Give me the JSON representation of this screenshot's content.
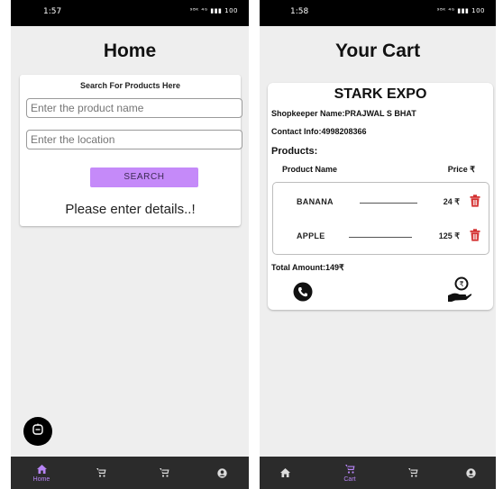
{
  "left": {
    "status": {
      "time": "1:57",
      "icons": "⁹⁸ᴷ ⁴ᴳ ▮▮▮ 100"
    },
    "title": "Home",
    "search": {
      "heading": "Search For Products Here",
      "product_placeholder": "Enter the product name",
      "location_placeholder": "Enter the location",
      "button_label": "SEARCH"
    },
    "message": "Please enter details..!",
    "nav": {
      "home_label": "Home"
    }
  },
  "right": {
    "status": {
      "time": "1:58",
      "icons": "⁹⁸ᴷ ⁴ᴳ ▮▮▮ 100"
    },
    "title": "Your Cart",
    "cart": {
      "shop_name": "STARK EXPO",
      "shopkeeper": "Shopkeeper Name:PRAJWAL S BHAT",
      "contact": "Contact Info:4998208366",
      "products_label": "Products:",
      "col_name": "Product Name",
      "col_price": "Price ₹",
      "items": [
        {
          "name": "BANANA",
          "price": "24 ₹"
        },
        {
          "name": "APPLE",
          "price": "125 ₹"
        }
      ],
      "total": "Total Amount:149₹"
    },
    "nav": {
      "cart_label": "Cart"
    }
  },
  "colors": {
    "accent": "#c58af9",
    "nav_bg": "#2b2b2b",
    "trash": "#d32f2f"
  }
}
